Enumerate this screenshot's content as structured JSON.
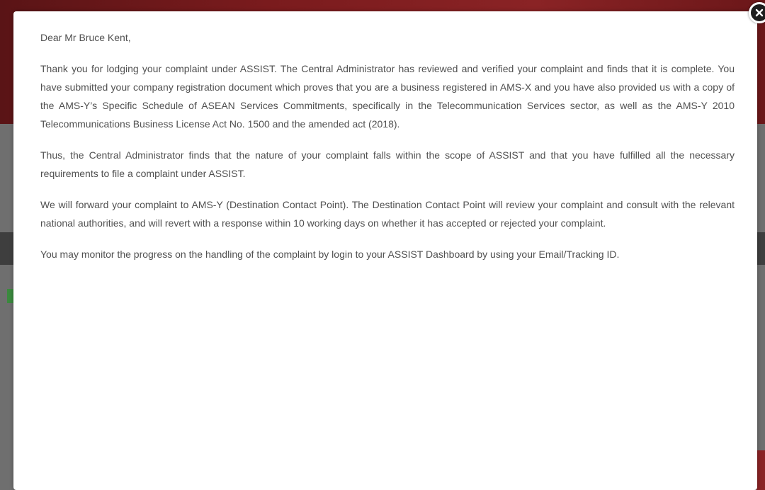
{
  "modal": {
    "salutation": "Dear Mr Bruce Kent,",
    "paragraphs": [
      "Thank you for lodging your complaint under ASSIST. The Central Administrator has reviewed and verified your complaint and finds that it is complete. You have submitted your company registration document which proves that you are a business registered in AMS-X and you have also provided us with a copy of the AMS-Y’s Specific Schedule of ASEAN Services Commitments, specifically in the Telecommunication Services sector, as well as the AMS-Y 2010 Telecommunications Business License Act No. 1500 and the amended act (2018).",
      "Thus, the Central Administrator finds that the nature of your complaint falls within the scope of ASSIST and that you have fulfilled all the necessary requirements to file a complaint under ASSIST.",
      "We will forward your complaint to AMS-Y (Destination Contact Point). The Destination Contact Point will review your complaint and consult with the relevant national authorities, and will revert with a response within 10 working days on whether it has accepted or rejected your complaint.",
      "You may monitor the progress on the handling of the complaint by login to your ASSIST Dashboard by using your Email/Tracking ID."
    ],
    "close_icon": "close-icon"
  },
  "colors": {
    "overlay": "#5c5c5c",
    "banner": "#7a1b1d",
    "modal_bg": "#ffffff",
    "text": "#505050",
    "close_bg": "#1e1e1e"
  }
}
